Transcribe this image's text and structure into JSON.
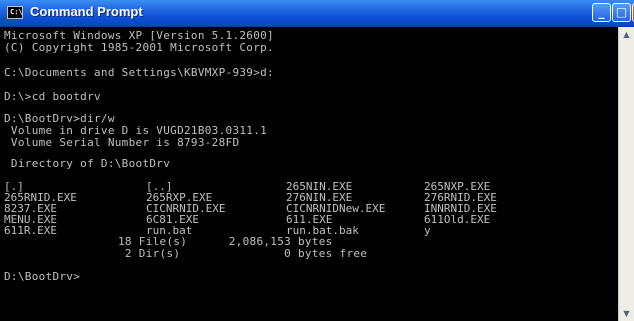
{
  "window": {
    "title": "Command Prompt",
    "icon_text": "C:\\",
    "buttons": {
      "minimize": "_",
      "maximize": "□",
      "close": "×"
    }
  },
  "console": {
    "lines": [
      "Microsoft Windows XP [Version 5.1.2600]",
      "(C) Copyright 1985-2001 Microsoft Corp.",
      "C:\\Documents and Settings\\KBVMXP-939>d:",
      "D:\\>cd bootdrv",
      "D:\\BootDrv>dir/w",
      " Volume in drive D is VUGD21B03.0311.1",
      " Volume Serial Number is 8793-28FD",
      " Directory of D:\\BootDrv",
      "18 File(s)      2,086,153 bytes",
      " 2 Dir(s)               0 bytes free",
      "D:\\BootDrv>"
    ],
    "listing": [
      [
        "[.]",
        "[..]",
        "265NIN.EXE",
        "265NXP.EXE"
      ],
      [
        "265RNID.EXE",
        "265RXP.EXE",
        "276NIN.EXE",
        "276RNID.EXE"
      ],
      [
        "8237.EXE",
        "CICNRNID.EXE",
        "CICNRNIDNew.EXE",
        "INNRNID.EXE"
      ],
      [
        "MENU.EXE",
        "6C81.EXE",
        "611.EXE",
        "611Old.EXE"
      ],
      [
        "611R.EXE",
        "run.bat",
        "run.bat.bak",
        "y"
      ]
    ]
  },
  "scrollbar": {
    "up_arrow": "▲",
    "down_arrow": "▼"
  }
}
